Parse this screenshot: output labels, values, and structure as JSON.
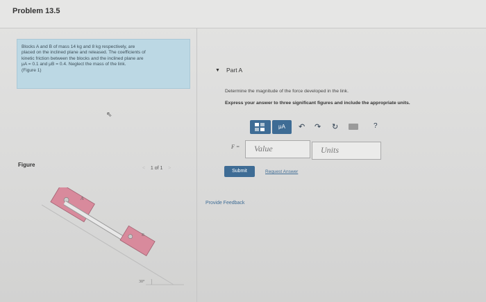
{
  "header": {
    "title": "Problem 13.5"
  },
  "problem": {
    "line1": "Blocks A and B of mass 14 kg and 8 kg respectively, are",
    "line2": "placed on the inclined plane and released. The coefficients of",
    "line3": "kinetic friction between the blocks and the inclined plane are",
    "line4": "μA = 0.1 and μB = 0.4. Neglect the mass of the link.",
    "line5": "(Figure 1)"
  },
  "figure": {
    "label": "Figure",
    "pager_prev": "<",
    "pager_text": "1 of 1",
    "pager_next": ">",
    "block_a_label": "A",
    "block_b_label": "B",
    "angle_label": "30°"
  },
  "part": {
    "label": "Part A",
    "prompt": "Determine the magnitude of the force developed in the link.",
    "instructions": "Express your answer to three significant figures and include the appropriate units."
  },
  "toolbar": {
    "units_button": "μA",
    "help": "?"
  },
  "answer": {
    "variable_label": "F =",
    "value_placeholder": "Value",
    "units_placeholder": "Units"
  },
  "actions": {
    "submit": "Submit",
    "request": "Request Answer",
    "feedback": "Provide Feedback"
  },
  "colors": {
    "accent": "#3e6c95",
    "problem_bg": "#bcd8e4",
    "block_fill": "#d88a9c"
  }
}
